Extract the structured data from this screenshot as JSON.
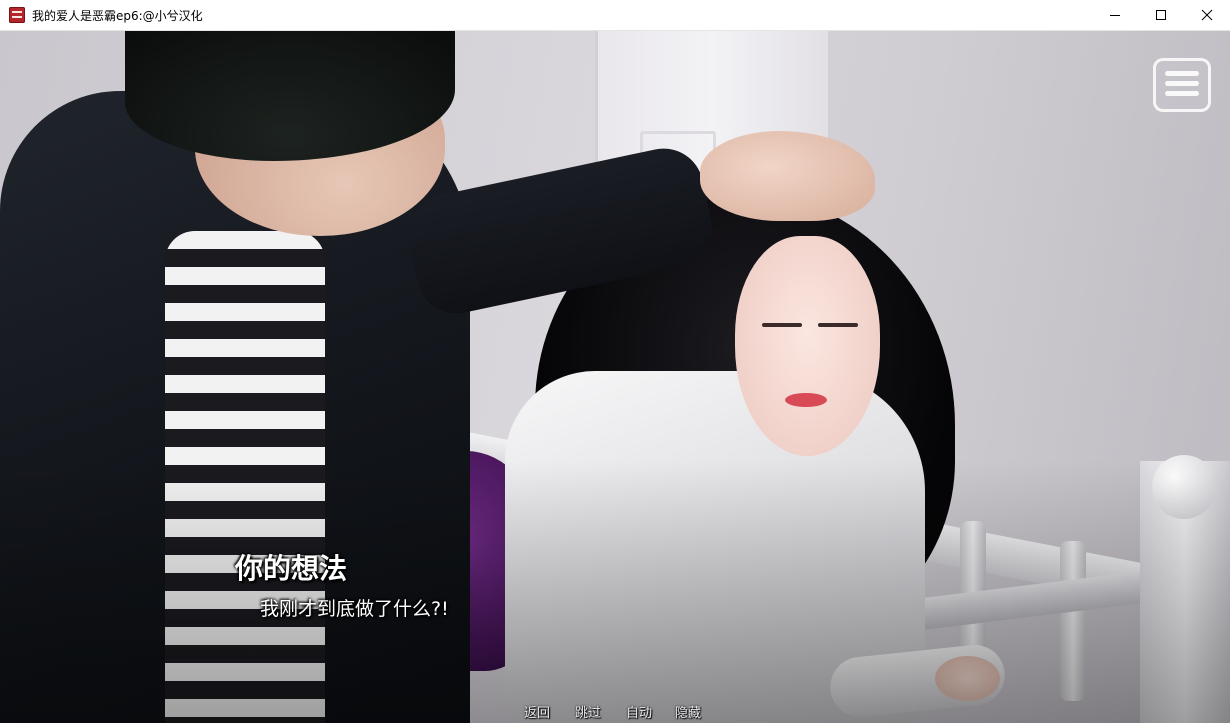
{
  "window": {
    "title": "我的爱人是恶霸ep6:@小兮汉化",
    "app_icon": "app-icon",
    "controls": [
      "minimize-icon",
      "maximize-icon",
      "close-icon"
    ]
  },
  "game": {
    "menu_icon": "hamburger-menu-icon",
    "dialogue": {
      "speaker": "你的想法",
      "text": "我刚才到底做了什么?!"
    },
    "quick_menu": {
      "back": "返回",
      "skip": "跳过",
      "auto": "自动",
      "hide": "隐藏"
    },
    "colors": {
      "dialogue_text": "#ffffff",
      "quick_menu_text": "#e8e8ea",
      "title_bar": "#ffffff"
    }
  }
}
